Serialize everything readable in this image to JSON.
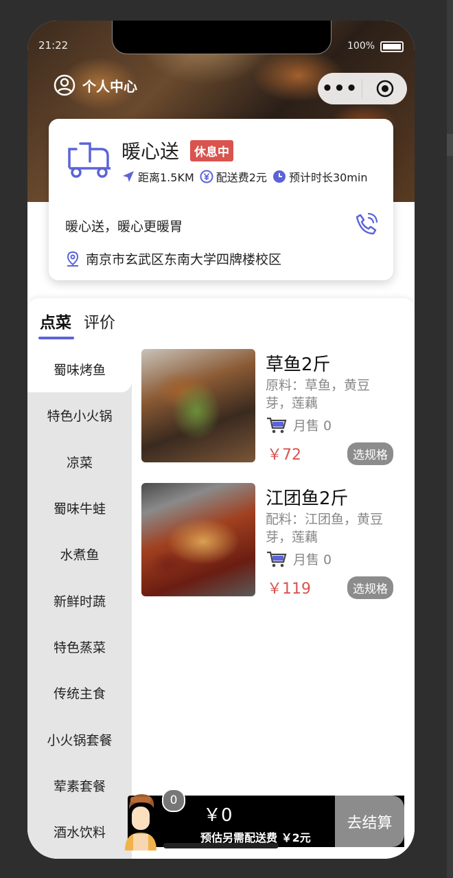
{
  "status_bar": {
    "time": "21:22",
    "battery": "100%"
  },
  "header": {
    "personal_center": "个人中心",
    "capsule_more": "•••"
  },
  "shop": {
    "name": "暖心送",
    "status_badge": "休息中",
    "distance": "距离1.5KM",
    "delivery_fee": "配送费2元",
    "eta": "预计时长30min",
    "slogan": "暖心送，暖心更暖胃",
    "address": "南京市玄武区东南大学四牌楼校区"
  },
  "tabs": [
    "点菜",
    "评价"
  ],
  "categories": [
    "蜀味烤鱼",
    "特色小火锅",
    "凉菜",
    "蜀味牛蛙",
    "水煮鱼",
    "新鲜时蔬",
    "特色蒸菜",
    "传统主食",
    "小火锅套餐",
    "荤素套餐",
    "酒水饮料"
  ],
  "dishes": [
    {
      "name": "草鱼2斤",
      "ingredients": "原料：草鱼，黄豆芽，莲藕",
      "monthly_sales": "月售 0",
      "price": "￥72",
      "spec_button": "选规格"
    },
    {
      "name": "江团鱼2斤",
      "ingredients": "配料：江团鱼，黄豆芽，莲藕",
      "monthly_sales": "月售 0",
      "price": "￥119",
      "spec_button": "选规格"
    }
  ],
  "cart": {
    "count": "0",
    "total": "￥0",
    "fee_note": "预估另需配送费 ￥2元",
    "checkout": "去结算"
  },
  "colors": {
    "accent": "#5b63d8",
    "badge": "#d9534f",
    "price": "#d9534f",
    "button_gray": "#8c8c8c"
  }
}
